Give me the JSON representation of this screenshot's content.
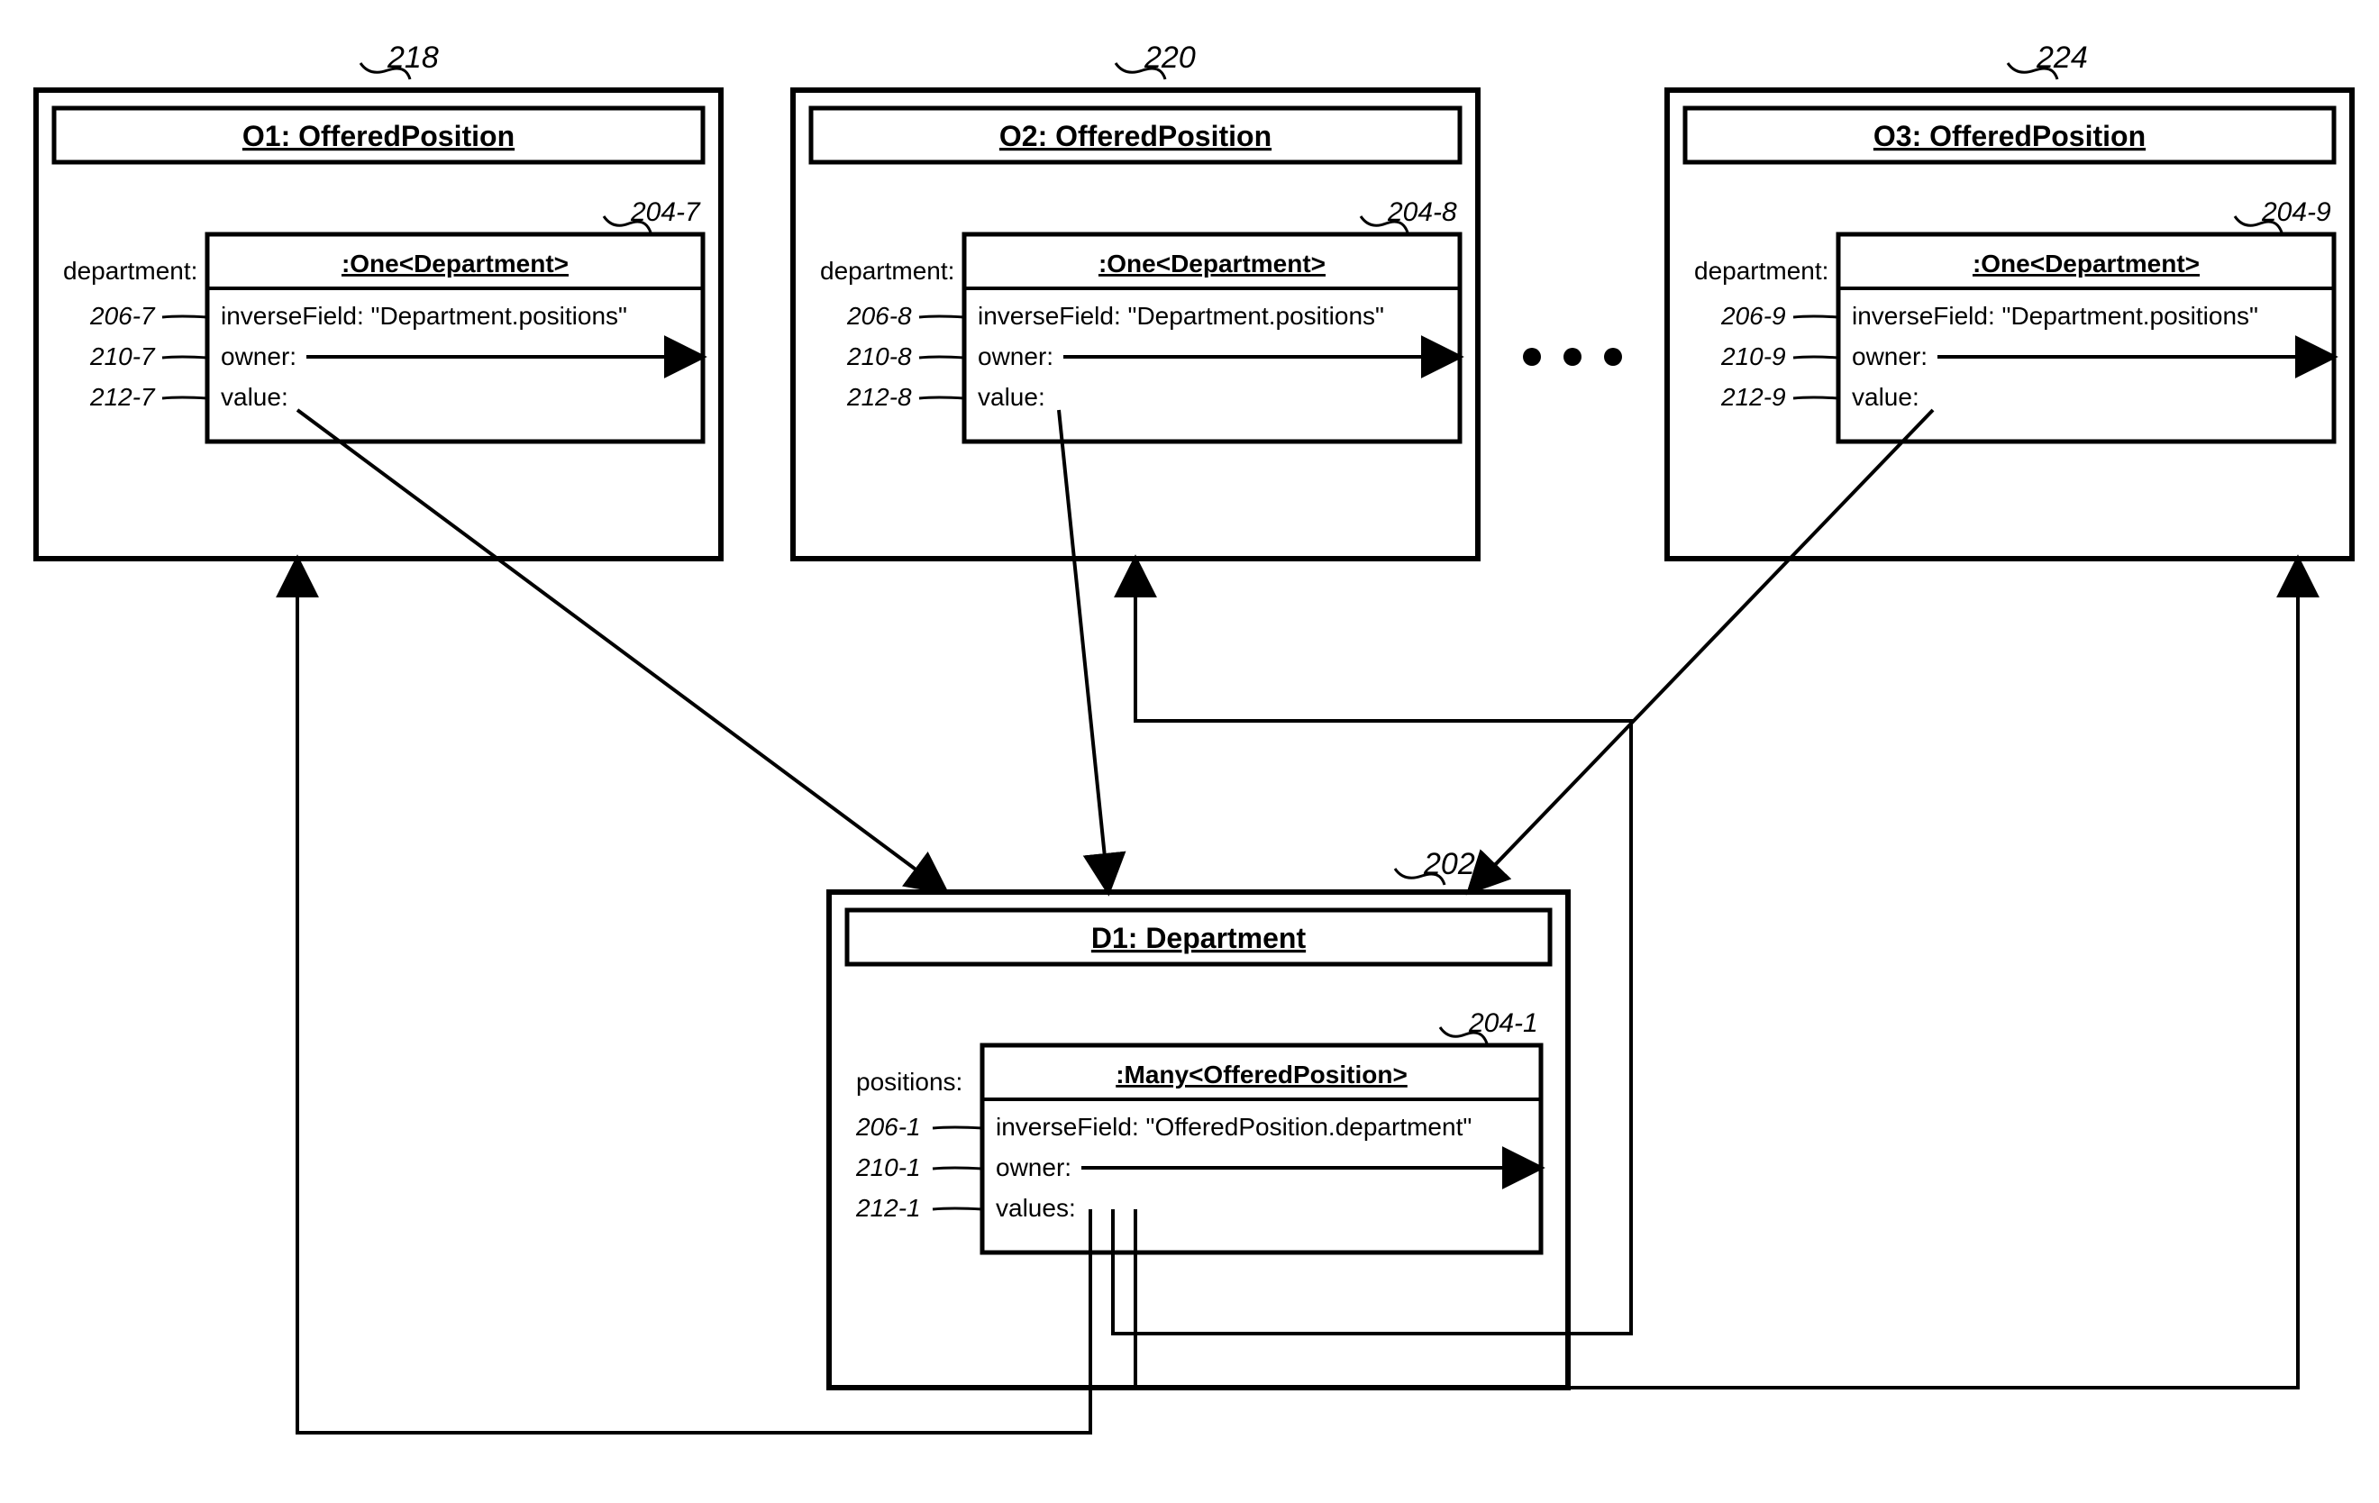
{
  "obj1": {
    "ref": "218",
    "title": "O1: OfferedPosition",
    "fieldLabel": "department:",
    "inner": {
      "ref": "204-7",
      "title": ":One<Department>",
      "inverse": "inverseField: \"Department.positions\"",
      "owner": "owner:",
      "value": "value:",
      "ref_inverse": "206-7",
      "ref_owner": "210-7",
      "ref_value": "212-7"
    }
  },
  "obj2": {
    "ref": "220",
    "title": "O2: OfferedPosition",
    "fieldLabel": "department:",
    "inner": {
      "ref": "204-8",
      "title": ":One<Department>",
      "inverse": "inverseField: \"Department.positions\"",
      "owner": "owner:",
      "value": "value:",
      "ref_inverse": "206-8",
      "ref_owner": "210-8",
      "ref_value": "212-8"
    }
  },
  "obj3": {
    "ref": "224",
    "title": "O3: OfferedPosition",
    "fieldLabel": "department:",
    "inner": {
      "ref": "204-9",
      "title": ":One<Department>",
      "inverse": "inverseField: \"Department.positions\"",
      "owner": "owner:",
      "value": "value:",
      "ref_inverse": "206-9",
      "ref_owner": "210-9",
      "ref_value": "212-9"
    }
  },
  "dept": {
    "ref": "202",
    "title": "D1: Department",
    "fieldLabel": "positions:",
    "inner": {
      "ref": "204-1",
      "title": ":Many<OfferedPosition>",
      "inverse": "inverseField:  \"OfferedPosition.department\"",
      "owner": "owner:",
      "value": "values:",
      "ref_inverse": "206-1",
      "ref_owner": "210-1",
      "ref_value": "212-1"
    }
  },
  "ellipsis": "● ● ●"
}
